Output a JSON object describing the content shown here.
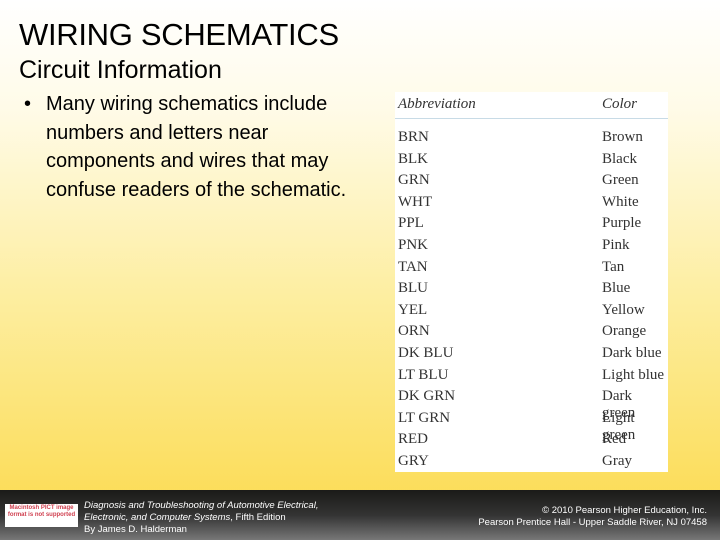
{
  "slide": {
    "title": "WIRING SCHEMATICS",
    "subtitle": "Circuit Information",
    "bullet": "Many wiring schematics include numbers and letters near components and wires that may confuse readers of the schematic."
  },
  "table": {
    "headers": [
      "Abbreviation",
      "Color"
    ],
    "rows": [
      [
        "BRN",
        "Brown"
      ],
      [
        "BLK",
        "Black"
      ],
      [
        "GRN",
        "Green"
      ],
      [
        "WHT",
        "White"
      ],
      [
        "PPL",
        "Purple"
      ],
      [
        "PNK",
        "Pink"
      ],
      [
        "TAN",
        "Tan"
      ],
      [
        "BLU",
        "Blue"
      ],
      [
        "YEL",
        "Yellow"
      ],
      [
        "ORN",
        "Orange"
      ],
      [
        "DK BLU",
        "Dark blue"
      ],
      [
        "LT BLU",
        "Light blue"
      ],
      [
        "DK GRN",
        "Dark green"
      ],
      [
        "LT GRN",
        "Light green"
      ],
      [
        "RED",
        "Red"
      ],
      [
        "GRY",
        "Gray"
      ]
    ]
  },
  "footer": {
    "placeholder_image_text": "Macintosh PICT image format is not supported",
    "book_line1": "Diagnosis and Troubleshooting of Automotive Electrical,",
    "book_line2_italic": "Electronic, and Computer Systems",
    "book_line2_rest": ", Fifth Edition",
    "book_line3": "By James D. Halderman",
    "copyright_line1": "© 2010 Pearson Higher Education, Inc.",
    "copyright_line2": "Pearson Prentice Hall - Upper Saddle River, NJ 07458"
  }
}
